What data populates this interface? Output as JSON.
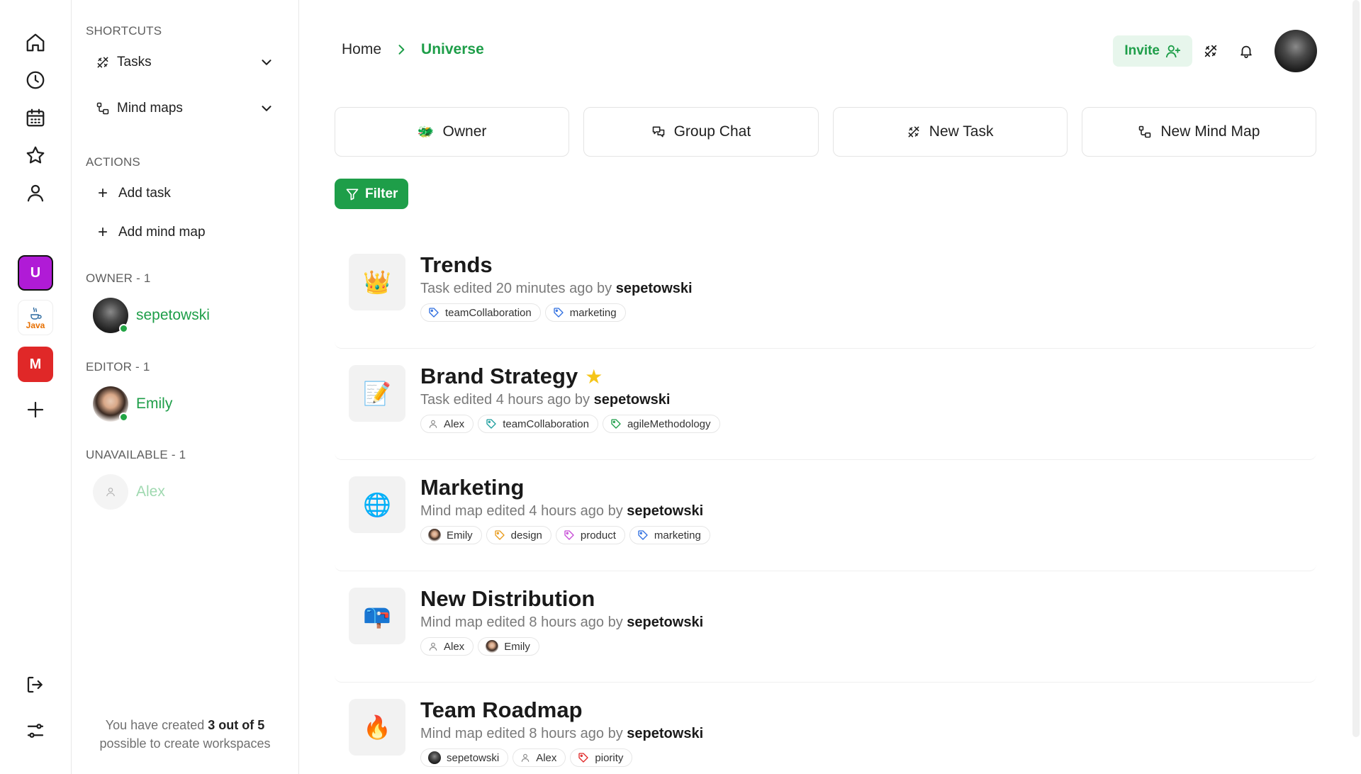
{
  "sidebar": {
    "shortcuts_title": "SHORTCUTS",
    "shortcuts": [
      {
        "label": "Tasks",
        "icon": "tasks-icon"
      },
      {
        "label": "Mind maps",
        "icon": "mindmap-icon"
      }
    ],
    "actions_title": "ACTIONS",
    "actions": [
      {
        "label": "Add task"
      },
      {
        "label": "Add mind map"
      }
    ],
    "owner_title": "OWNER - 1",
    "owner_name": "sepetowski",
    "editor_title": "EDITOR - 1",
    "editor_name": "Emily",
    "unavailable_title": "UNAVAILABLE - 1",
    "unavailable_name": "Alex",
    "quota_prefix": "You have created ",
    "quota_bold": "3 out of 5",
    "quota_suffix": "possible to create workspaces"
  },
  "rail": {
    "workspace_u": "U",
    "workspace_java": "Java",
    "workspace_m": "M",
    "workspace_u_color": "#b01bd6",
    "workspace_m_color": "#e02828"
  },
  "header": {
    "breadcrumb_home": "Home",
    "breadcrumb_current": "Universe",
    "invite_label": "Invite"
  },
  "quick_actions": [
    {
      "label": "Owner",
      "icon": "shield-emoji-icon"
    },
    {
      "label": "Group Chat",
      "icon": "chat-icon"
    },
    {
      "label": "New Task",
      "icon": "tasks-icon"
    },
    {
      "label": "New Mind Map",
      "icon": "mindmap-icon"
    }
  ],
  "filter_label": "Filter",
  "accent_color": "#1e9e49",
  "cards": [
    {
      "title": "Trends",
      "emoji": "👑",
      "starred": false,
      "meta_prefix": "Task edited 20 minutes ago by ",
      "author": "sepetowski",
      "tags": [
        {
          "type": "tag",
          "label": "teamCollaboration",
          "color": "#2f6fe0"
        },
        {
          "type": "tag",
          "label": "marketing",
          "color": "#2f6fe0"
        }
      ]
    },
    {
      "title": "Brand Strategy",
      "emoji": "📝",
      "starred": true,
      "meta_prefix": "Task edited 4 hours ago by ",
      "author": "sepetowski",
      "tags": [
        {
          "type": "user",
          "label": "Alex"
        },
        {
          "type": "tag",
          "label": "teamCollaboration",
          "color": "#1e9e9e"
        },
        {
          "type": "tag",
          "label": "agileMethodology",
          "color": "#1e9e49"
        }
      ]
    },
    {
      "title": "Marketing",
      "emoji": "🌐",
      "starred": false,
      "meta_prefix": "Mind map edited 4 hours ago by ",
      "author": "sepetowski",
      "tags": [
        {
          "type": "avatar-emily",
          "label": "Emily"
        },
        {
          "type": "tag",
          "label": "design",
          "color": "#e89a1a"
        },
        {
          "type": "tag",
          "label": "product",
          "color": "#c64ad6"
        },
        {
          "type": "tag",
          "label": "marketing",
          "color": "#2f6fe0"
        }
      ]
    },
    {
      "title": "New Distribution",
      "emoji": "📪",
      "starred": false,
      "meta_prefix": "Mind map edited 8 hours ago by ",
      "author": "sepetowski",
      "tags": [
        {
          "type": "user",
          "label": "Alex"
        },
        {
          "type": "avatar-emily",
          "label": "Emily"
        }
      ]
    },
    {
      "title": "Team Roadmap",
      "emoji": "🔥",
      "starred": false,
      "meta_prefix": "Mind map edited 8 hours ago by ",
      "author": "sepetowski",
      "tags": [
        {
          "type": "avatar-dark",
          "label": "sepetowski"
        },
        {
          "type": "user",
          "label": "Alex"
        },
        {
          "type": "tag",
          "label": "piority",
          "color": "#e02828"
        }
      ]
    }
  ]
}
